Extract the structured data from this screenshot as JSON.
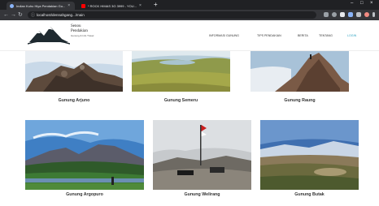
{
  "browser": {
    "tabs": [
      {
        "title": "Indian Kuhu Hiya Pendakian Gu...",
        "favicon_color": "#8ab4f8",
        "active": true
      },
      {
        "title": "* ROCK HIMAS 3G 3999 - YOU...",
        "favicon_color": "#ff0000",
        "active": false
      }
    ],
    "new_tab": "+",
    "url": "localhost/dennahgang.../main"
  },
  "site": {
    "brand": {
      "line1": "Senou",
      "line2": "Pendakian",
      "tagline": "Gunung & Info Travel"
    },
    "nav": [
      {
        "label": "INFORMASI GUNUNG",
        "active": false
      },
      {
        "label": "TIPS PENDAKIAN",
        "active": false
      },
      {
        "label": "BERITA",
        "active": false
      },
      {
        "label": "TENTANG",
        "active": false
      },
      {
        "label": "LOGIN",
        "active": true
      }
    ]
  },
  "mountains": [
    {
      "name": "Gunung Arjuno"
    },
    {
      "name": "Gunung Semeru"
    },
    {
      "name": "Gunung Raung"
    },
    {
      "name": "Gunung Argopuro"
    },
    {
      "name": "Gunung Welirang"
    },
    {
      "name": "Gunung Butak"
    }
  ]
}
